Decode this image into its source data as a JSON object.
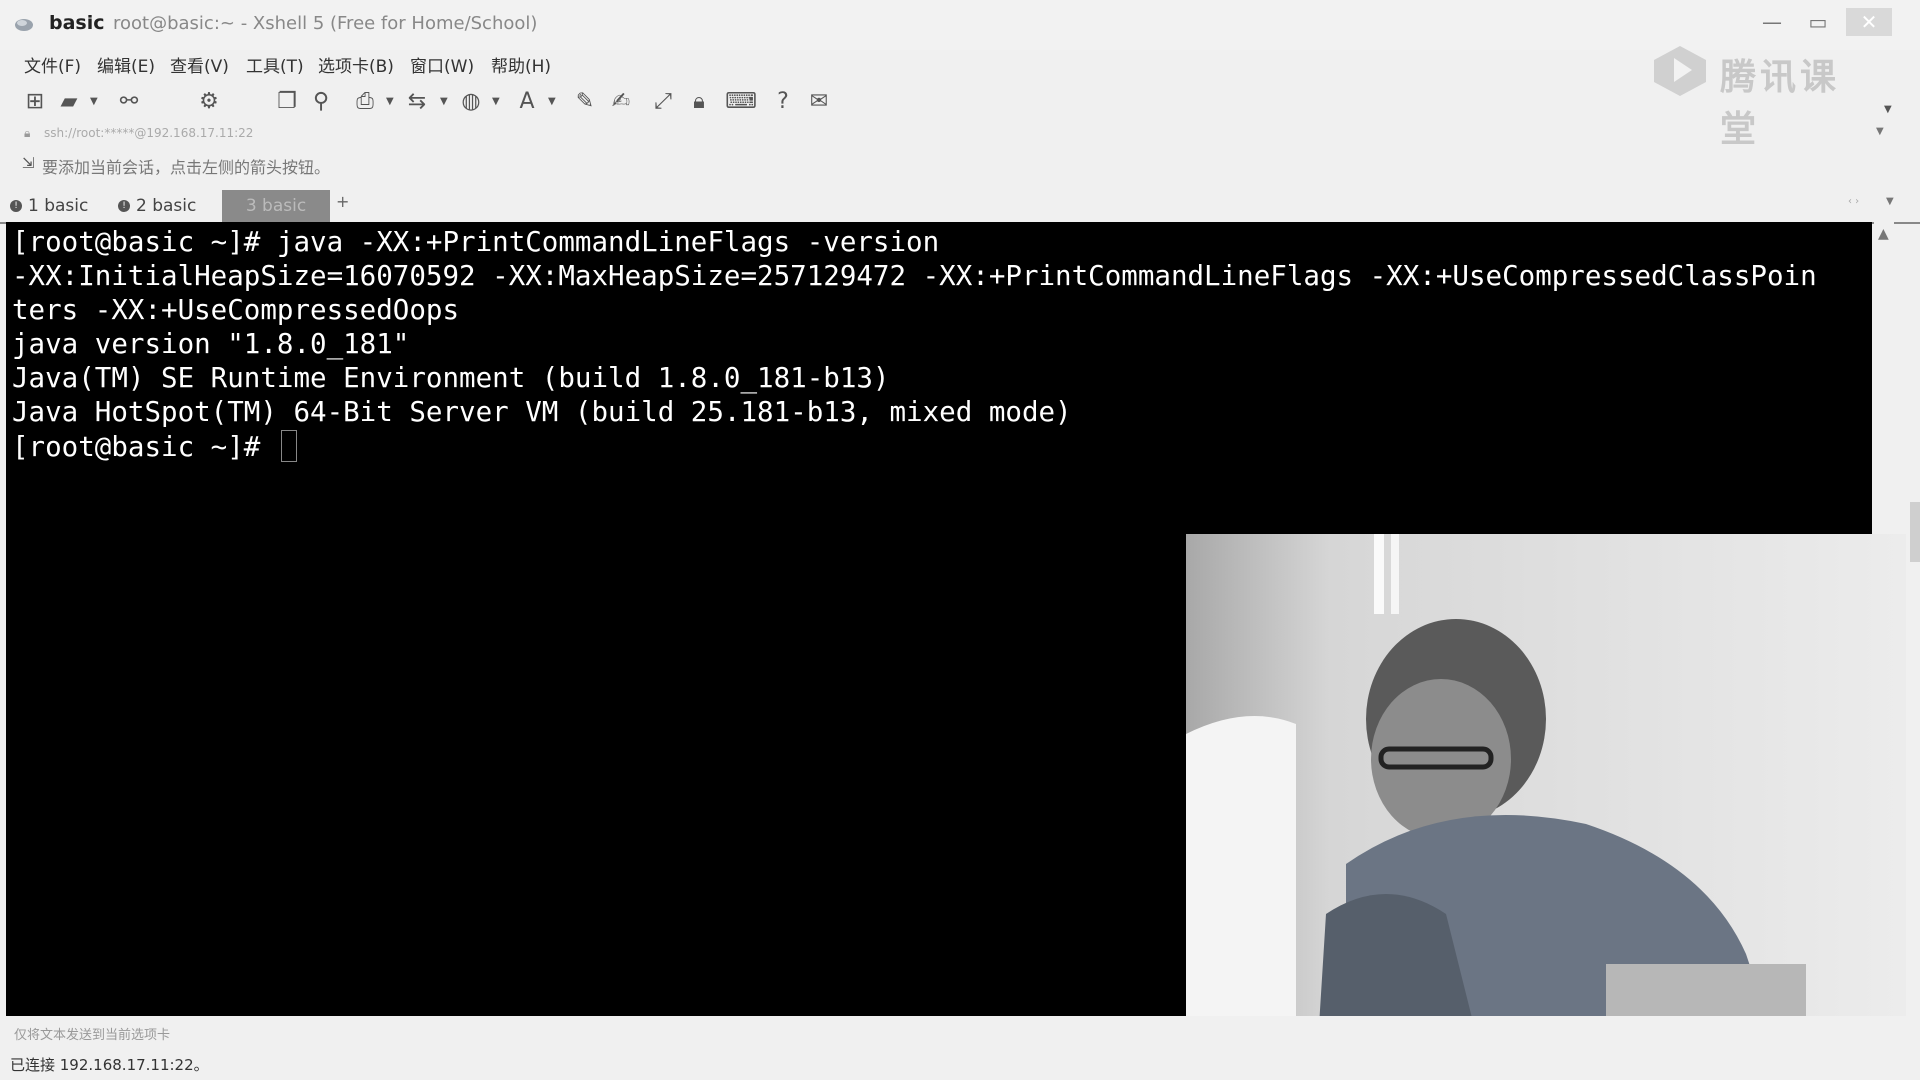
{
  "window": {
    "app_name": "basic",
    "subtitle": "root@basic:~ - Xshell 5 (Free for Home/School)",
    "minimize_glyph": "—",
    "maximize_glyph": "▭",
    "close_glyph": "✕"
  },
  "menu": {
    "items": [
      {
        "label": "文件(F)"
      },
      {
        "label": "编辑(E)"
      },
      {
        "label": "查看(V)"
      },
      {
        "label": "工具(T)"
      },
      {
        "label": "选项卡(B)"
      },
      {
        "label": "窗口(W)"
      },
      {
        "label": "帮助(H)"
      }
    ]
  },
  "watermark": {
    "text": "腾讯课堂"
  },
  "toolbar": {
    "icons": [
      "new-session-icon",
      "open-folder-icon",
      "reconnect-icon",
      "properties-icon",
      "copy-icon",
      "find-icon",
      "print-icon",
      "transfer-icon",
      "globe-icon",
      "font-icon",
      "script-icon",
      "compose-icon",
      "fullscreen-icon",
      "lock-icon",
      "keyboard-icon",
      "help-icon",
      "chat-icon"
    ]
  },
  "address": {
    "value": "ssh://root:*****@192.168.17.11:22"
  },
  "hint": {
    "text": "要添加当前会话，点击左侧的箭头按钮。"
  },
  "tabs": [
    {
      "num": "1",
      "label": "1 basic",
      "active": false
    },
    {
      "num": "2",
      "label": "2 basic",
      "active": false
    },
    {
      "num": "3",
      "label": "3 basic",
      "active": true
    }
  ],
  "tab_add": "+",
  "terminal": {
    "lines": [
      "[root@basic ~]# java -XX:+PrintCommandLineFlags -version",
      "-XX:InitialHeapSize=16070592 -XX:MaxHeapSize=257129472 -XX:+PrintCommandLineFlags -XX:+UseCompressedClassPoin",
      "ters -XX:+UseCompressedOops",
      "java version \"1.8.0_181\"",
      "Java(TM) SE Runtime Environment (build 1.8.0_181-b13)",
      "Java HotSpot(TM) 64-Bit Server VM (build 25.181-b13, mixed mode)",
      "[root@basic ~]# "
    ]
  },
  "status": {
    "send_hint": "仅将文本发送到当前选项卡",
    "connection": "已连接 192.168.17.11:22。"
  },
  "colors": {
    "terminal_bg": "#000000",
    "terminal_fg": "#ffffff",
    "active_tab": "#8a8a8a"
  }
}
